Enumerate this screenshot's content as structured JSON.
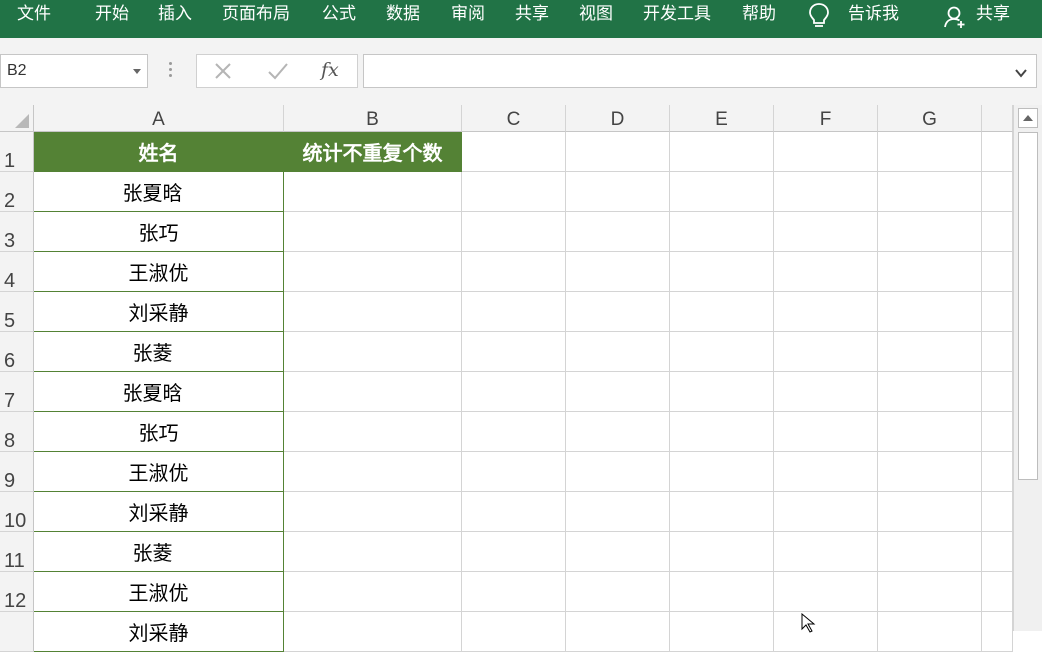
{
  "ribbon": {
    "tabs": [
      "文件",
      "开始",
      "插入",
      "页面布局",
      "公式",
      "数据",
      "审阅",
      "共享",
      "视图",
      "开发工具",
      "帮助"
    ],
    "tell_me": "告诉我",
    "share": "共享",
    "bg_color": "#217346"
  },
  "formula_bar": {
    "name_box": "B2",
    "fx_label": "fx",
    "formula": ""
  },
  "sheet": {
    "columns": [
      "A",
      "B",
      "C",
      "D",
      "E",
      "F",
      "G"
    ],
    "rows": [
      "1",
      "2",
      "3",
      "4",
      "5",
      "6",
      "7",
      "8",
      "9",
      "10",
      "11",
      "12"
    ],
    "header_fill": "#548235",
    "a_header": "姓名",
    "b_header": "统计不重复个数",
    "names": [
      "张夏晗",
      "张巧",
      "王淑优",
      "刘采静",
      "张菱",
      "张夏晗",
      "张巧",
      "王淑优",
      "刘采静",
      "张菱",
      "王淑优",
      "刘采静"
    ]
  }
}
